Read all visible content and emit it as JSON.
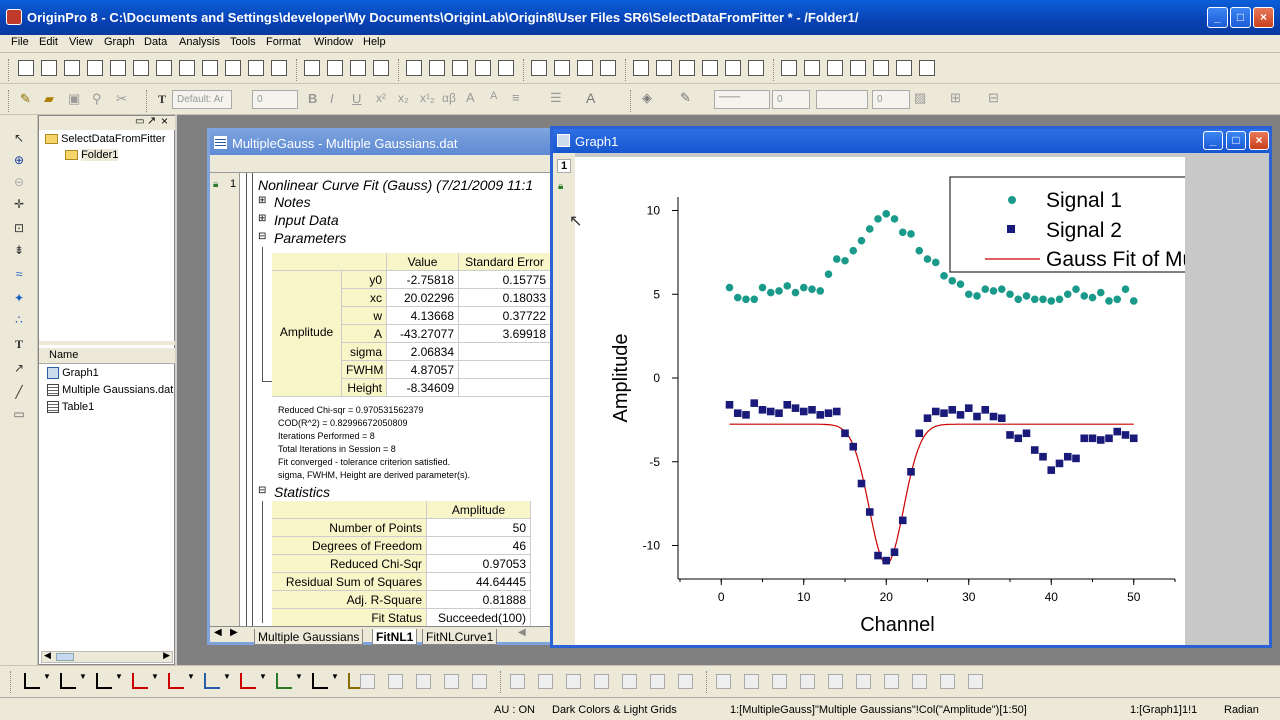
{
  "app": {
    "title": "OriginPro 8 - C:\\Documents and Settings\\developer\\My Documents\\OriginLab\\Origin8\\User Files SR6\\SelectDataFromFitter * - /Folder1/"
  },
  "menu": [
    "File",
    "Edit",
    "View",
    "Graph",
    "Data",
    "Analysis",
    "Tools",
    "Format",
    "Window",
    "Help"
  ],
  "format_bar": {
    "font_placeholder": "Default: Ar",
    "size_value": "0",
    "line_value": "0",
    "line2_value": "0"
  },
  "project": {
    "root": "SelectDataFromFitter",
    "folder": "Folder1",
    "list_header": "Name",
    "items": [
      "Graph1",
      "Multiple Gaussians.dat",
      "Table1"
    ]
  },
  "workbook": {
    "title": "MultipleGauss - Multiple Gaussians.dat",
    "row_number": "1",
    "report_title": "Nonlinear Curve Fit (Gauss) (7/21/2009 11:1",
    "sections": {
      "notes": "Notes",
      "input": "Input Data",
      "params": "Parameters",
      "stats": "Statistics"
    },
    "param_headers": [
      "Value",
      "Standard Error"
    ],
    "param_group": "Amplitude",
    "params": [
      {
        "name": "y0",
        "value": "-2.75818",
        "err": "0.15775"
      },
      {
        "name": "xc",
        "value": "20.02296",
        "err": "0.18033"
      },
      {
        "name": "w",
        "value": "4.13668",
        "err": "0.37722"
      },
      {
        "name": "A",
        "value": "-43.27077",
        "err": "3.69918"
      },
      {
        "name": "sigma",
        "value": "2.06834",
        "err": ""
      },
      {
        "name": "FWHM",
        "value": "4.87057",
        "err": ""
      },
      {
        "name": "Height",
        "value": "-8.34609",
        "err": ""
      }
    ],
    "notes_text": [
      "Reduced Chi-sqr = 0.970531562379",
      "COD(R^2) = 0.82996672050809",
      "Iterations Performed = 8",
      "Total Iterations in Session = 8",
      "Fit converged - tolerance criterion satisfied.",
      "sigma, FWHM, Height are derived parameter(s)."
    ],
    "stats_header": "Amplitude",
    "stats": [
      {
        "name": "Number of Points",
        "value": "50"
      },
      {
        "name": "Degrees of Freedom",
        "value": "46"
      },
      {
        "name": "Reduced Chi-Sqr",
        "value": "0.97053"
      },
      {
        "name": "Residual Sum of Squares",
        "value": "44.64445"
      },
      {
        "name": "Adj. R-Square",
        "value": "0.81888"
      },
      {
        "name": "Fit Status",
        "value": "Succeeded(100)"
      }
    ],
    "tabs": [
      "Multiple Gaussians",
      "FitNL1",
      "FitNLCurve1"
    ]
  },
  "graph": {
    "title": "Graph1",
    "layer": "1"
  },
  "chart_data": {
    "type": "scatter",
    "xlabel": "Channel",
    "ylabel": "Amplitude",
    "xlim": [
      -5,
      55
    ],
    "ylim": [
      -12,
      12
    ],
    "xticks": [
      0,
      10,
      20,
      30,
      40,
      50
    ],
    "yticks": [
      -10,
      -5,
      0,
      5,
      10
    ],
    "legend_position": "top-right",
    "series": [
      {
        "name": "Signal 1",
        "marker": "circle",
        "color": "#1a9a8a",
        "x": [
          1,
          2,
          3,
          4,
          5,
          6,
          7,
          8,
          9,
          10,
          11,
          12,
          13,
          14,
          15,
          16,
          17,
          18,
          19,
          20,
          21,
          22,
          23,
          24,
          25,
          26,
          27,
          28,
          29,
          30,
          31,
          32,
          33,
          34,
          35,
          36,
          37,
          38,
          39,
          40,
          41,
          42,
          43,
          44,
          45,
          46,
          47,
          48,
          49,
          50
        ],
        "y": [
          5.4,
          4.8,
          4.7,
          4.7,
          5.4,
          5.1,
          5.2,
          5.5,
          5.1,
          5.4,
          5.3,
          5.2,
          6.2,
          7.1,
          7.0,
          7.6,
          8.2,
          8.9,
          9.5,
          9.8,
          9.5,
          8.7,
          8.6,
          7.6,
          7.1,
          6.9,
          6.1,
          5.8,
          5.6,
          5.0,
          4.9,
          5.3,
          5.2,
          5.3,
          5.0,
          4.7,
          4.9,
          4.7,
          4.7,
          4.6,
          4.7,
          5.0,
          5.3,
          4.9,
          4.8,
          5.1,
          4.6,
          4.7,
          5.3,
          4.6
        ]
      },
      {
        "name": "Signal 2",
        "marker": "square",
        "color": "#1a1a7a",
        "x": [
          1,
          2,
          3,
          4,
          5,
          6,
          7,
          8,
          9,
          10,
          11,
          12,
          13,
          14,
          15,
          16,
          17,
          18,
          19,
          20,
          21,
          22,
          23,
          24,
          25,
          26,
          27,
          28,
          29,
          30,
          31,
          32,
          33,
          34,
          35,
          36,
          37,
          38,
          39,
          40,
          41,
          42,
          43,
          44,
          45,
          46,
          47,
          48,
          49,
          50
        ],
        "y": [
          -1.6,
          -2.1,
          -2.2,
          -1.5,
          -1.9,
          -2.0,
          -2.1,
          -1.6,
          -1.8,
          -2.0,
          -1.9,
          -2.2,
          -2.1,
          -2.0,
          -3.3,
          -4.1,
          -6.3,
          -8.0,
          -10.6,
          -10.9,
          -10.4,
          -8.5,
          -5.6,
          -3.3,
          -2.4,
          -2.0,
          -2.1,
          -1.9,
          -2.2,
          -1.8,
          -2.3,
          -1.9,
          -2.3,
          -2.4,
          -3.4,
          -3.6,
          -3.3,
          -4.3,
          -4.7,
          -5.5,
          -5.1,
          -4.7,
          -4.8,
          -3.6,
          -3.6,
          -3.7,
          -3.6,
          -3.2,
          -3.4,
          -3.6
        ]
      },
      {
        "name": "Gauss Fit of Multiple G",
        "marker": "line",
        "color": "#cc0000",
        "y0": -2.75818,
        "xc": 20.02296,
        "w": 4.13668,
        "A": -43.27077,
        "x_range": [
          1,
          50
        ]
      }
    ]
  },
  "status": {
    "au": "AU : ON",
    "theme": "Dark Colors & Light Grids",
    "column": "1:[MultipleGauss]\"Multiple Gaussians\"!Col(\"Amplitude\")[1:50]",
    "layer": "1:[Graph1]1!1",
    "angle": "Radian"
  }
}
